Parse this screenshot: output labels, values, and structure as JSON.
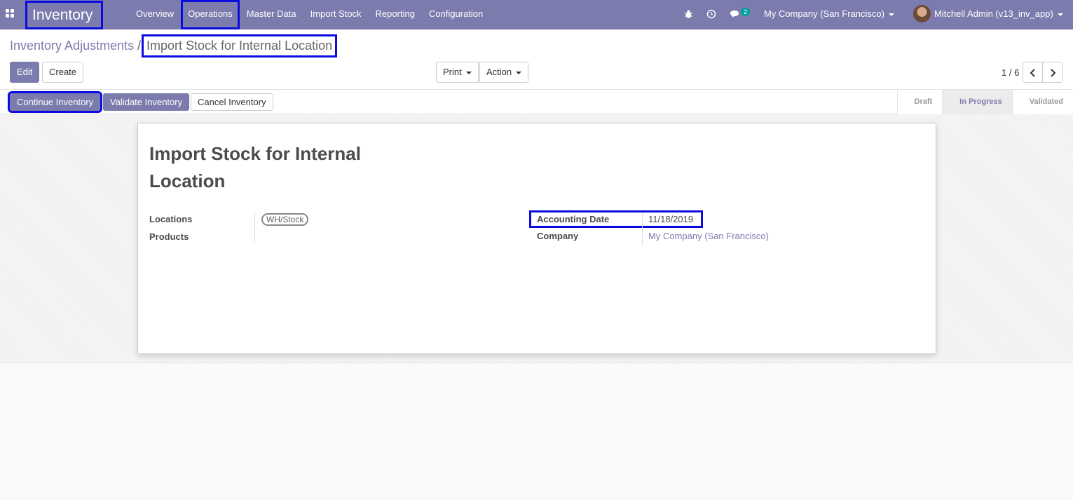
{
  "navbar": {
    "app_name": "Inventory",
    "menu": [
      "Overview",
      "Operations",
      "Master Data",
      "Import Stock",
      "Reporting",
      "Configuration"
    ],
    "message_count": "2",
    "company": "My Company (San Francisco)",
    "user": "Mitchell Admin (v13_inv_app)"
  },
  "breadcrumb": {
    "parent": "Inventory Adjustments",
    "separator": "/",
    "current": "Import Stock for Internal Location"
  },
  "toolbar": {
    "edit": "Edit",
    "create": "Create",
    "print": "Print",
    "action": "Action",
    "pager": "1 / 6"
  },
  "statusbar": {
    "continue": "Continue Inventory",
    "validate": "Validate Inventory",
    "cancel": "Cancel Inventory",
    "stages": [
      "Draft",
      "In Progress",
      "Validated"
    ]
  },
  "record": {
    "title": "Import Stock for Internal Location",
    "locations_label": "Locations",
    "locations_tag": "WH/Stock",
    "products_label": "Products",
    "accounting_date_label": "Accounting Date",
    "accounting_date": "11/18/2019",
    "company_label": "Company",
    "company": "My Company (San Francisco)"
  },
  "colors": {
    "brand": "#7c7bad",
    "highlight": "#0b0be0",
    "badge": "#00a09d"
  }
}
